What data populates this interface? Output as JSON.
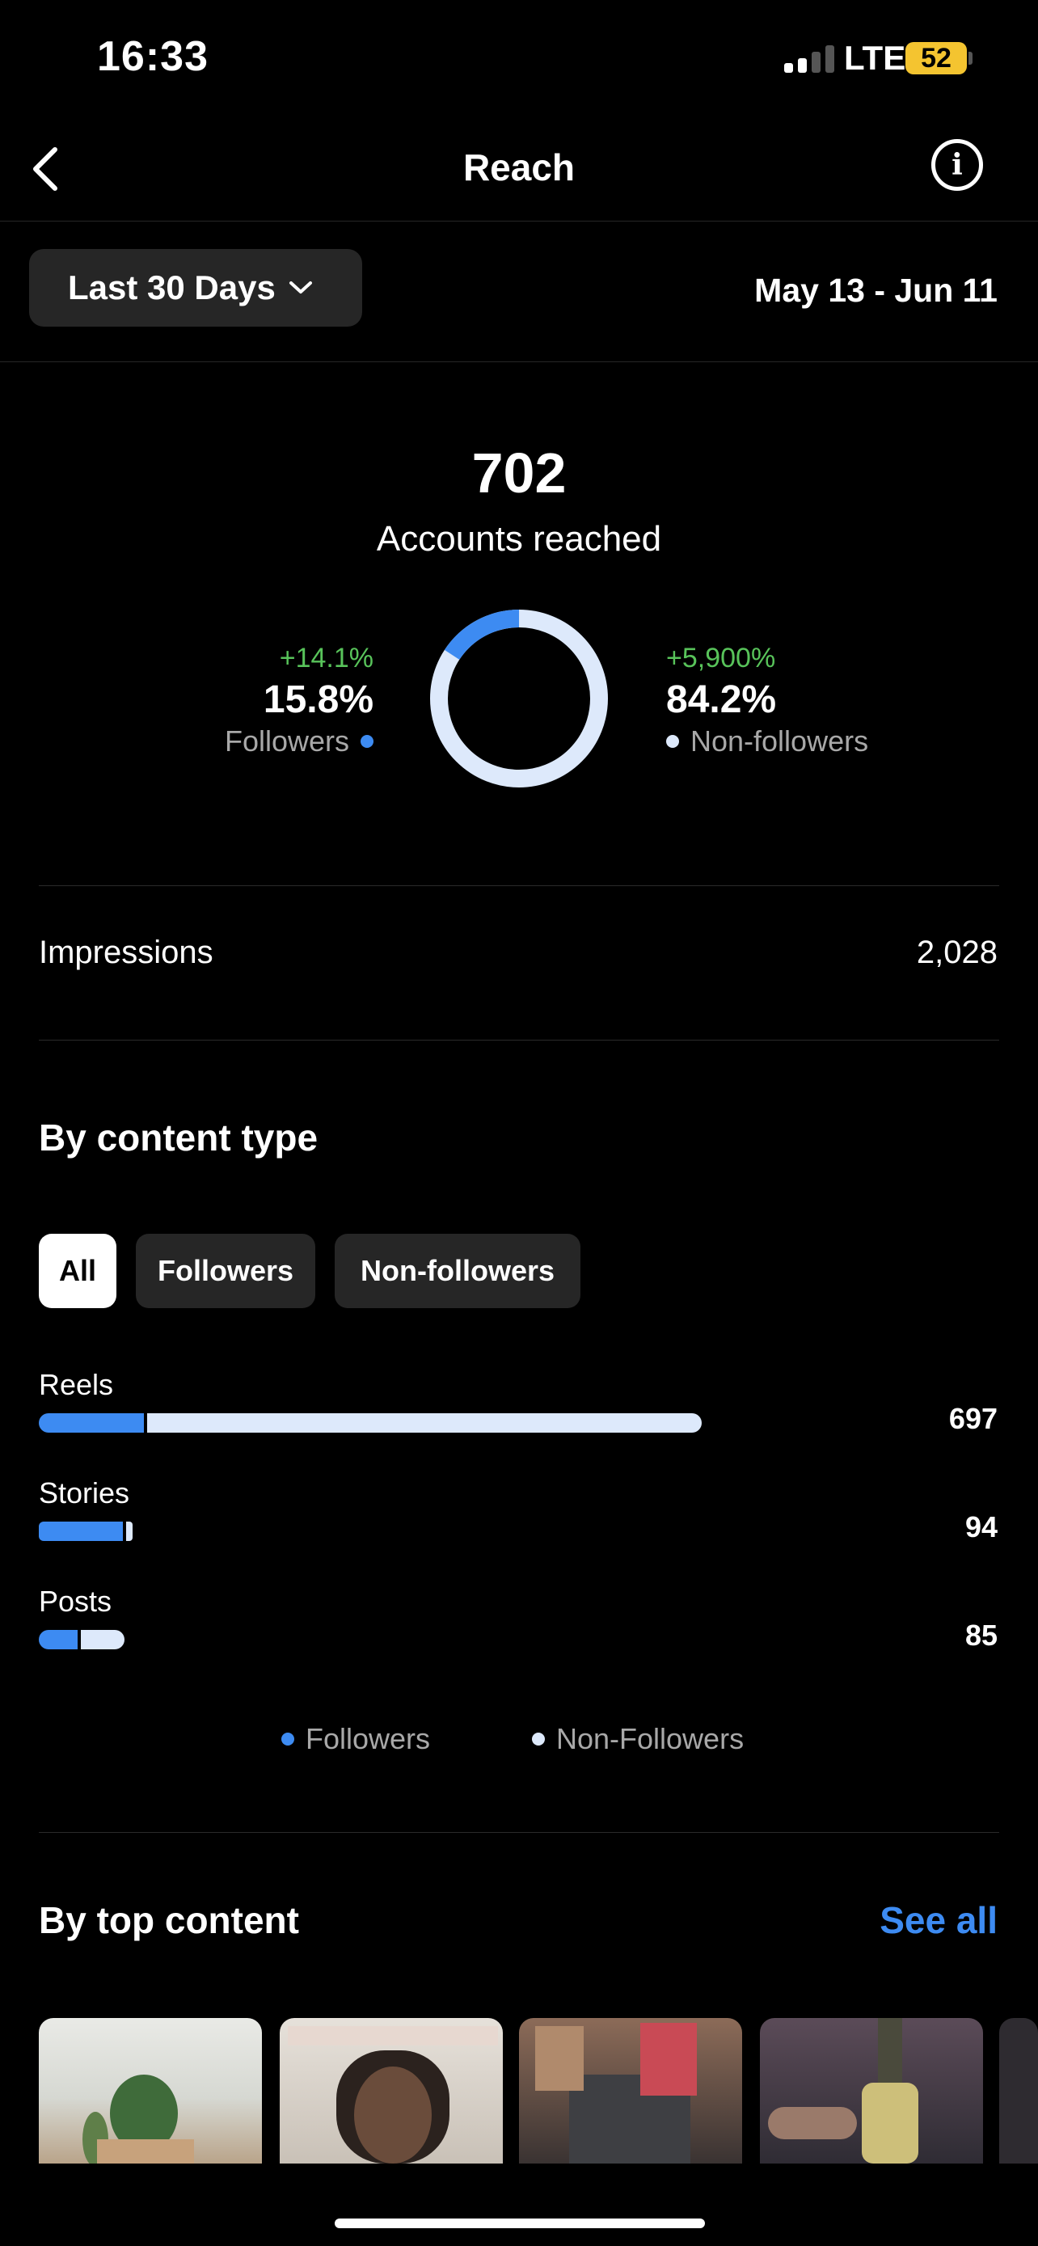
{
  "status_bar": {
    "time": "16:33",
    "network": "LTE",
    "battery": "52"
  },
  "header": {
    "title": "Reach"
  },
  "date_filter": {
    "range_label": "Last 30 Days",
    "dates": "May 13 - Jun 11"
  },
  "summary": {
    "total": "702",
    "total_label": "Accounts reached",
    "followers": {
      "change": "+14.1%",
      "percent": "15.8%",
      "label": "Followers",
      "fraction": 0.158
    },
    "non_followers": {
      "change": "+5,900%",
      "percent": "84.2%",
      "label": "Non-followers"
    }
  },
  "impressions": {
    "label": "Impressions",
    "value": "2,028"
  },
  "content_type": {
    "title": "By content type",
    "filters": [
      "All",
      "Followers",
      "Non-followers"
    ],
    "active_filter": "All",
    "rows": [
      {
        "label": "Reels",
        "value": "697"
      },
      {
        "label": "Stories",
        "value": "94"
      },
      {
        "label": "Posts",
        "value": "85"
      }
    ],
    "legend": [
      "Followers",
      "Non-Followers"
    ]
  },
  "top_content": {
    "title": "By top content",
    "see_all": "See all"
  },
  "colors": {
    "followers": "#3d8bf2",
    "non_followers": "#dde9fb",
    "positive": "#58c35a",
    "link": "#3d8bf2"
  },
  "icons": [
    "back-arrow-icon",
    "info-icon",
    "chevron-down-icon"
  ]
}
